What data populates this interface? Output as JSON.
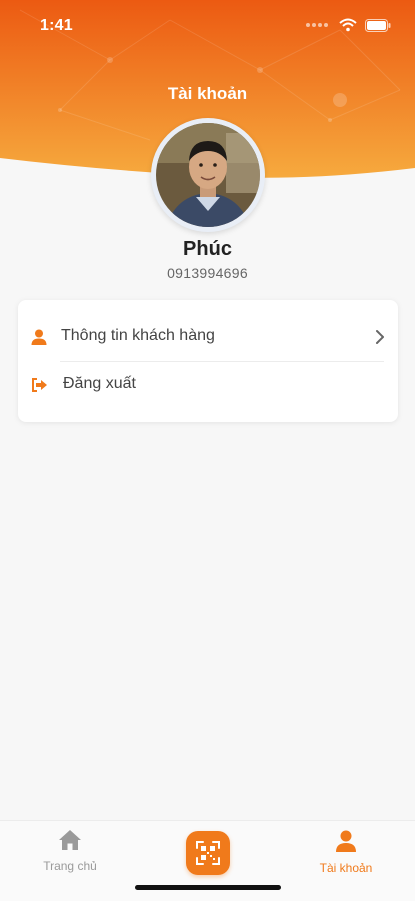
{
  "status_bar": {
    "time": "1:41"
  },
  "header": {
    "title": "Tài khoản"
  },
  "profile": {
    "name": "Phúc",
    "phone": "0913994696"
  },
  "menu": {
    "items": [
      {
        "label": "Thông tin khách hàng",
        "icon": "user-icon",
        "has_arrow": true
      },
      {
        "label": "Đăng xuất",
        "icon": "logout-icon",
        "has_arrow": false
      }
    ]
  },
  "bottom_nav": {
    "items": [
      {
        "label": "Trang chủ",
        "icon": "home-icon",
        "active": false
      },
      {
        "label": "",
        "icon": "qr-scan-icon",
        "active": false
      },
      {
        "label": "Tài khoản",
        "icon": "user-icon",
        "active": true
      }
    ]
  },
  "colors": {
    "accent": "#f07a1b",
    "header_top": "#ee5d12",
    "header_bottom": "#f7a53a"
  }
}
